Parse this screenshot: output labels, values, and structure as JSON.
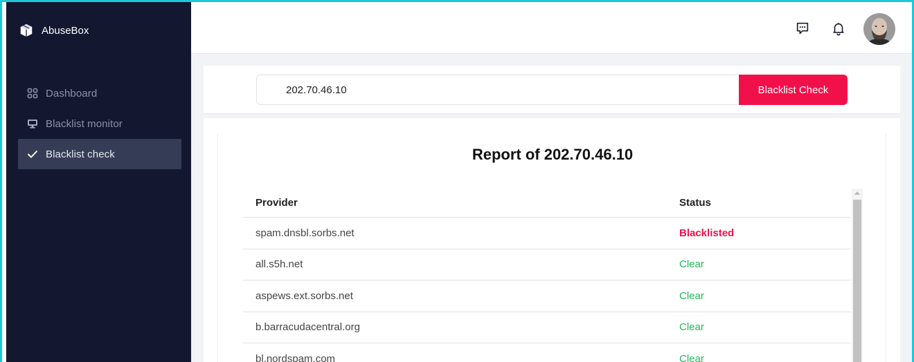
{
  "app": {
    "name": "AbuseBox"
  },
  "sidebar": {
    "items": [
      {
        "label": "Dashboard",
        "icon": "grid-icon"
      },
      {
        "label": "Blacklist monitor",
        "icon": "monitor-icon"
      },
      {
        "label": "Blacklist check",
        "icon": "check-icon",
        "active": true
      }
    ]
  },
  "topbar": {
    "icons": [
      "message-icon",
      "bell-icon",
      "avatar"
    ]
  },
  "search": {
    "value": "202.70.46.10",
    "button_label": "Blacklist Check"
  },
  "report": {
    "title": "Report of 202.70.46.10",
    "columns": [
      "Provider",
      "Status"
    ],
    "rows": [
      {
        "provider": "spam.dnsbl.sorbs.net",
        "status": "Blacklisted"
      },
      {
        "provider": "all.s5h.net",
        "status": "Clear"
      },
      {
        "provider": "aspews.ext.sorbs.net",
        "status": "Clear"
      },
      {
        "provider": "b.barracudacentral.org",
        "status": "Clear"
      },
      {
        "provider": "bl.nordspam.com",
        "status": "Clear"
      }
    ]
  },
  "colors": {
    "sidebar_bg": "#13172f",
    "accent": "#f2104a",
    "clear": "#25b55a",
    "blacklisted": "#f2104a"
  }
}
